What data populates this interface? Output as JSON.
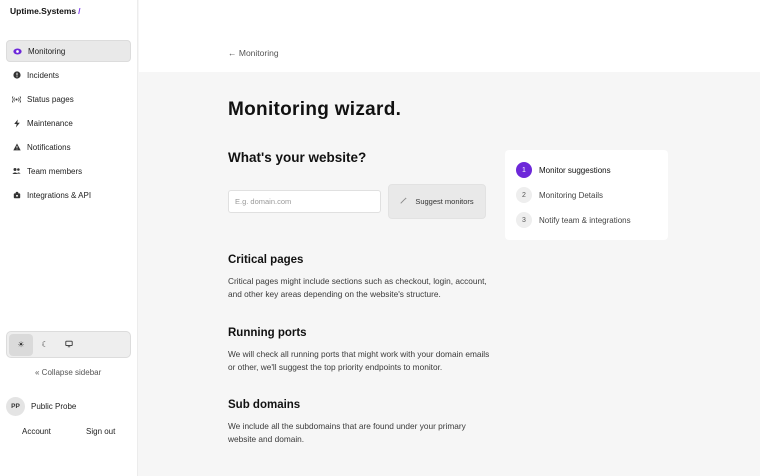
{
  "brand": {
    "name": "Uptime.Systems",
    "slash": "/"
  },
  "sidebar": {
    "items": [
      {
        "label": "Monitoring",
        "icon": "eye-icon",
        "active": true
      },
      {
        "label": "Incidents",
        "icon": "alert-circle-icon"
      },
      {
        "label": "Status pages",
        "icon": "broadcast-icon"
      },
      {
        "label": "Maintenance",
        "icon": "lightning-icon"
      },
      {
        "label": "Notifications",
        "icon": "warning-triangle-icon"
      },
      {
        "label": "Team members",
        "icon": "users-icon"
      },
      {
        "label": "Integrations & API",
        "icon": "puzzle-icon"
      }
    ],
    "theme": {
      "light_icon": "☀",
      "dark_icon": "☾",
      "system_icon": "🖵",
      "selected": "light"
    },
    "collapse_label": "« Collapse sidebar",
    "user": {
      "initials": "PP",
      "name": "Public Probe"
    },
    "account_label": "Account",
    "signout_label": "Sign out"
  },
  "header": {
    "back_label": "← Monitoring"
  },
  "main": {
    "title": "Monitoring wizard.",
    "question": "What's your website?",
    "domain_input": {
      "value": "",
      "placeholder": "E.g. domain.com"
    },
    "suggest_button": {
      "icon": "magic-wand-icon",
      "label": "Suggest monitors"
    },
    "sections": [
      {
        "title": "Critical pages",
        "text": "Critical pages might include sections such as checkout, login, account, and other key areas depending on the website's structure."
      },
      {
        "title": "Running ports",
        "text": "We will check all running ports that might work with your domain emails or other, we'll suggest the top priority endpoints to monitor."
      },
      {
        "title": "Sub domains",
        "text": "We include all the subdomains that are found under your primary website and domain."
      }
    ]
  },
  "steps": [
    {
      "number": "1",
      "label": "Monitor suggestions",
      "active": true
    },
    {
      "number": "2",
      "label": "Monitoring Details"
    },
    {
      "number": "3",
      "label": "Notify team & integrations"
    }
  ],
  "colors": {
    "accent": "#6d28d9",
    "sidebar_bg": "#ffffff",
    "page_bg": "#f6f6f6"
  }
}
